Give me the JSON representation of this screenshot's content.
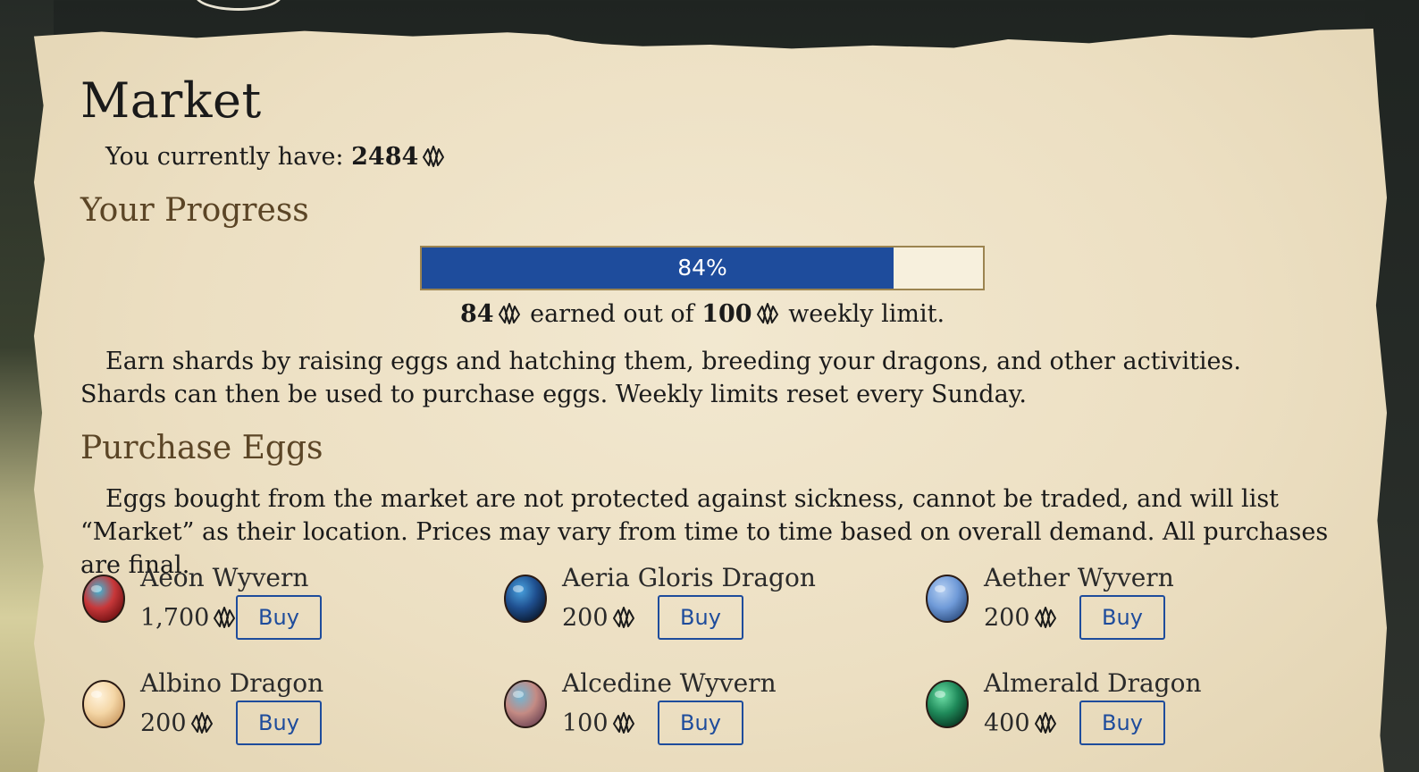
{
  "market": {
    "title": "Market",
    "currency_prefix": "You currently have: ",
    "currency_amount": "2484",
    "currency_icon": "shard-icon"
  },
  "progress": {
    "heading": "Your Progress",
    "percent": 84,
    "percent_label": "84%",
    "earned": "84",
    "earned_middle": " earned out of ",
    "limit": "100",
    "limit_suffix": " weekly limit."
  },
  "info": {
    "text": "Earn shards by raising eggs and hatching them, breeding your dragons, and other activities. Shards can then be used to purchase eggs. Weekly limits reset every Sunday."
  },
  "purchase": {
    "heading": "Purchase Eggs",
    "text": "Eggs bought from the market are not protected against sickness, cannot be traded, and will list “Market” as their location. Prices may vary from time to time based on overall demand. All purchases are final.",
    "buy_label": "Buy",
    "eggs": [
      {
        "name": "Aeon Wyvern",
        "price": "1,700",
        "colors": [
          "#c8383a",
          "#3fb6d6",
          "#7a1416"
        ]
      },
      {
        "name": "Aeria Gloris Dragon",
        "price": "200",
        "colors": [
          "#1f4f8f",
          "#4aa3e0",
          "#0c1f3a"
        ]
      },
      {
        "name": "Aether Wyvern",
        "price": "200",
        "colors": [
          "#6f9ad8",
          "#b6d0f2",
          "#34568a"
        ]
      },
      {
        "name": "Albino Dragon",
        "price": "200",
        "colors": [
          "#f4d6a6",
          "#fff3dc",
          "#d0a26a"
        ]
      },
      {
        "name": "Alcedine Wyvern",
        "price": "100",
        "colors": [
          "#c48b84",
          "#6fb7d6",
          "#7a4e5a"
        ]
      },
      {
        "name": "Almerald Dragon",
        "price": "400",
        "colors": [
          "#1f8a5a",
          "#6fe0a8",
          "#0b3f27"
        ]
      }
    ]
  }
}
